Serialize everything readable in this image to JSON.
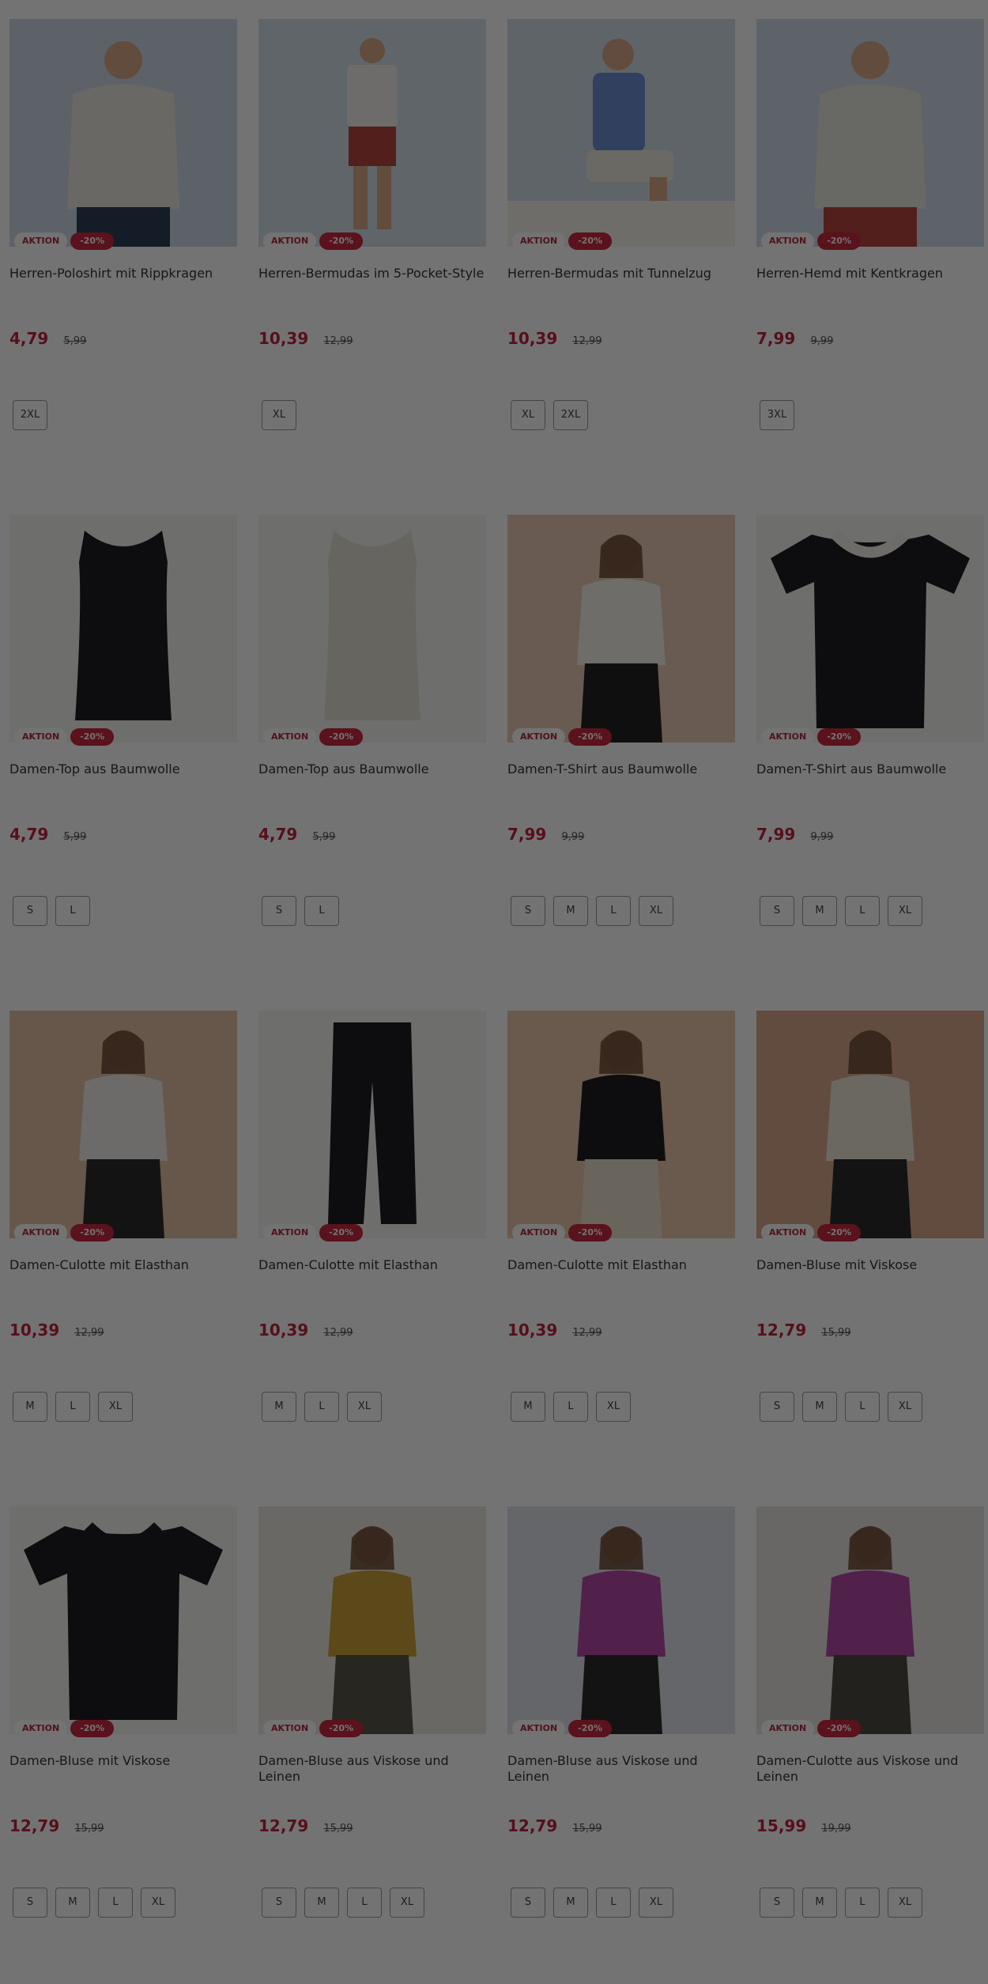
{
  "products": [
    {
      "title": "Herren-Poloshirt mit Rippkragen",
      "price": "4,79",
      "old_price": "5,99",
      "aktion": "AKTION",
      "discount": "-20%",
      "sizes": [
        "2XL"
      ],
      "image": {
        "bg": "#cdd9e6",
        "figure": "#e8e6e0",
        "accent": "#2e3e5a",
        "kind": "man-polo"
      }
    },
    {
      "title": "Herren-Bermudas im 5-Pocket-Style",
      "price": "10,39",
      "old_price": "12,99",
      "aktion": "AKTION",
      "discount": "-20%",
      "sizes": [
        "XL"
      ],
      "image": {
        "bg": "#d6e0ea",
        "figure": "#f2f0ea",
        "accent": "#b9463e",
        "kind": "man-shorts"
      }
    },
    {
      "title": "Herren-Bermudas mit Tunnelzug",
      "price": "10,39",
      "old_price": "12,99",
      "aktion": "AKTION",
      "discount": "-20%",
      "sizes": [
        "XL",
        "2XL"
      ],
      "image": {
        "bg": "#d2dde9",
        "figure": "#6a8fd0",
        "accent": "#ece8dc",
        "kind": "man-sitting"
      }
    },
    {
      "title": "Herren-Hemd mit Kentkragen",
      "price": "7,99",
      "old_price": "9,99",
      "aktion": "AKTION",
      "discount": "-20%",
      "sizes": [
        "3XL"
      ],
      "image": {
        "bg": "#cfdbe8",
        "figure": "#e6e6de",
        "accent": "#b9463e",
        "kind": "man-shirt"
      }
    },
    {
      "title": "Damen-Top aus Baumwolle",
      "price": "4,79",
      "old_price": "5,99",
      "aktion": "AKTION",
      "discount": "-20%",
      "sizes": [
        "S",
        "L"
      ],
      "image": {
        "bg": "#f4f3f1",
        "figure": "#1e1e22",
        "accent": "#1e1e22",
        "kind": "top"
      }
    },
    {
      "title": "Damen-Top aus Baumwolle",
      "price": "4,79",
      "old_price": "5,99",
      "aktion": "AKTION",
      "discount": "-20%",
      "sizes": [
        "S",
        "L"
      ],
      "image": {
        "bg": "#f4f3f1",
        "figure": "#e2dfd3",
        "accent": "#e2dfd3",
        "kind": "top"
      }
    },
    {
      "title": "Damen-T-Shirt aus Baumwolle",
      "price": "7,99",
      "old_price": "9,99",
      "aktion": "AKTION",
      "discount": "-20%",
      "sizes": [
        "S",
        "M",
        "L",
        "XL"
      ],
      "image": {
        "bg": "#e9cbb4",
        "figure": "#f3f1ec",
        "accent": "#222",
        "kind": "woman"
      }
    },
    {
      "title": "Damen-T-Shirt aus Baumwolle",
      "price": "7,99",
      "old_price": "9,99",
      "aktion": "AKTION",
      "discount": "-20%",
      "sizes": [
        "S",
        "M",
        "L",
        "XL"
      ],
      "image": {
        "bg": "#f4f3f1",
        "figure": "#1e1e22",
        "accent": "#f2efe6",
        "kind": "tee"
      }
    },
    {
      "title": "Damen-Culotte mit Elasthan",
      "price": "10,39",
      "old_price": "12,99",
      "aktion": "AKTION",
      "discount": "-20%",
      "sizes": [
        "M",
        "L",
        "XL"
      ],
      "image": {
        "bg": "#e5c2a6",
        "figure": "#f0eee8",
        "accent": "#2a2a2a",
        "kind": "woman"
      }
    },
    {
      "title": "Damen-Culotte mit Elasthan",
      "price": "10,39",
      "old_price": "12,99",
      "aktion": "AKTION",
      "discount": "-20%",
      "sizes": [
        "M",
        "L",
        "XL"
      ],
      "image": {
        "bg": "#f4f3f1",
        "figure": "#1e1e22",
        "accent": "#1e1e22",
        "kind": "pants"
      }
    },
    {
      "title": "Damen-Culotte mit Elasthan",
      "price": "10,39",
      "old_price": "12,99",
      "aktion": "AKTION",
      "discount": "-20%",
      "sizes": [
        "M",
        "L",
        "XL"
      ],
      "image": {
        "bg": "#e8c7ac",
        "figure": "#1e1e22",
        "accent": "#e9e1cc",
        "kind": "woman"
      }
    },
    {
      "title": "Damen-Bluse mit Viskose",
      "price": "12,79",
      "old_price": "15,99",
      "aktion": "AKTION",
      "discount": "-20%",
      "sizes": [
        "S",
        "M",
        "L",
        "XL"
      ],
      "image": {
        "bg": "#d9a88e",
        "figure": "#ede6da",
        "accent": "#2a2a2a",
        "kind": "woman"
      }
    },
    {
      "title": "Damen-Bluse mit Viskose",
      "price": "12,79",
      "old_price": "15,99",
      "aktion": "AKTION",
      "discount": "-20%",
      "sizes": [
        "S",
        "M",
        "L",
        "XL"
      ],
      "image": {
        "bg": "#f4f3f1",
        "figure": "#1e1e22",
        "accent": "#1e1e22",
        "kind": "tee"
      }
    },
    {
      "title": "Damen-Bluse aus Viskose und Leinen",
      "price": "12,79",
      "old_price": "15,99",
      "aktion": "AKTION",
      "discount": "-20%",
      "sizes": [
        "S",
        "M",
        "L",
        "XL"
      ],
      "image": {
        "bg": "#ece7df",
        "figure": "#c9a23a",
        "accent": "#5a5448",
        "kind": "woman"
      }
    },
    {
      "title": "Damen-Bluse aus Viskose und Leinen",
      "price": "12,79",
      "old_price": "15,99",
      "aktion": "AKTION",
      "discount": "-20%",
      "sizes": [
        "S",
        "M",
        "L",
        "XL"
      ],
      "image": {
        "bg": "#dfe3ea",
        "figure": "#b34aa6",
        "accent": "#2a2a2a",
        "kind": "woman"
      }
    },
    {
      "title": "Damen-Culotte aus Viskose und Leinen",
      "price": "15,99",
      "old_price": "19,99",
      "aktion": "AKTION",
      "discount": "-20%",
      "sizes": [
        "S",
        "M",
        "L",
        "XL"
      ],
      "image": {
        "bg": "#e6e5e1",
        "figure": "#b34aa6",
        "accent": "#4f4a40",
        "kind": "woman"
      }
    }
  ]
}
